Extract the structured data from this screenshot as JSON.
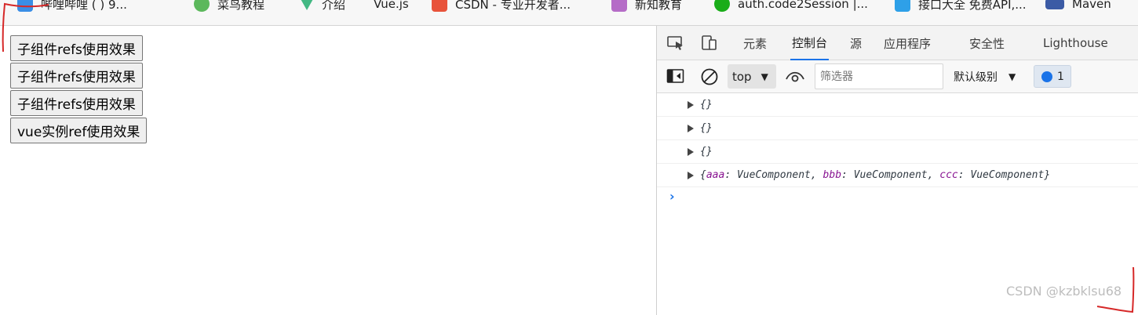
{
  "bookmarks": [
    {
      "label": "哔哩哔哩 (   ) 9...",
      "icon": "bilibili-icon",
      "color": "#3a8ee6"
    },
    {
      "label": "菜鸟教程",
      "icon": "runoob-icon",
      "color": "#5cb85c"
    },
    {
      "label": "介绍",
      "icon": "vue-icon",
      "color": "#42b883"
    },
    {
      "label": "Vue.js",
      "icon": "",
      "color": ""
    },
    {
      "label": "CSDN - 专业开发者...",
      "icon": "csdn-icon",
      "color": "#e8533b"
    },
    {
      "label": "新知教育",
      "icon": "xinzhi-icon",
      "color": "#b56cc7"
    },
    {
      "label": "auth.code2Session |...",
      "icon": "wechat-icon",
      "color": "#1aad19"
    },
    {
      "label": "接口大全 免费API,...",
      "icon": "api-icon",
      "color": "#2ea0e8"
    },
    {
      "label": "Maven",
      "icon": "maven-icon",
      "color": "#3b5ba5"
    }
  ],
  "page": {
    "buttons": [
      {
        "label": "子组件refs使用效果"
      },
      {
        "label": "子组件refs使用效果"
      },
      {
        "label": "子组件refs使用效果"
      },
      {
        "label": "vue实例ref使用效果"
      }
    ]
  },
  "devtools": {
    "tabs": [
      {
        "label": "元素"
      },
      {
        "label": "控制台",
        "active": true
      },
      {
        "label": "源"
      },
      {
        "label": "应用程序"
      },
      {
        "label": "安全性"
      },
      {
        "label": "Lighthouse"
      }
    ],
    "toolbar": {
      "context": "top",
      "filter_placeholder": "筛选器",
      "level": "默认级别",
      "issues_count": "1"
    },
    "console_lines": [
      {
        "text": "{}"
      },
      {
        "text": "{}"
      },
      {
        "text": "{}"
      },
      {
        "text": "{aaa: VueComponent, bbb: VueComponent, ccc: VueComponent}"
      }
    ],
    "prompt": "›"
  },
  "watermark": "CSDN @kzbklsu68",
  "colors": {
    "accent": "#1a73e8",
    "annotation": "#d62828"
  }
}
